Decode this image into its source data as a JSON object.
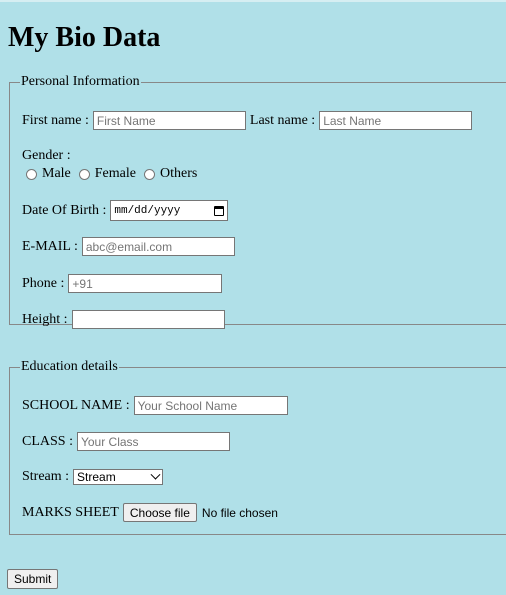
{
  "page": {
    "title": "My Bio Data"
  },
  "personal": {
    "legend": "Personal Information",
    "first_name_label": "First name :",
    "first_name_placeholder": "First Name",
    "last_name_label": "Last name :",
    "last_name_placeholder": "Last Name",
    "gender_label": "Gender :",
    "gender_options": [
      "Male",
      "Female",
      "Others"
    ],
    "dob_label": "Date Of Birth :",
    "dob_value": "mm/dd/yyyy",
    "email_label": "E-MAIL :",
    "email_placeholder": "abc@email.com",
    "phone_label": "Phone :",
    "phone_placeholder": "+91",
    "height_label": "Height :",
    "height_value": ""
  },
  "education": {
    "legend": "Education details",
    "school_label": "SCHOOL NAME :",
    "school_placeholder": "Your School Name",
    "class_label": "CLASS :",
    "class_placeholder": "Your Class",
    "stream_label": "Stream :",
    "stream_selected": "Stream",
    "marks_label": "MARKS SHEET",
    "file_button": "Choose file",
    "file_status": "No file chosen"
  },
  "actions": {
    "submit_label": "Submit"
  },
  "icons": {
    "date": "calendar-icon",
    "select": "chevron-down-icon"
  },
  "colors": {
    "background": "#b0e0e8"
  }
}
